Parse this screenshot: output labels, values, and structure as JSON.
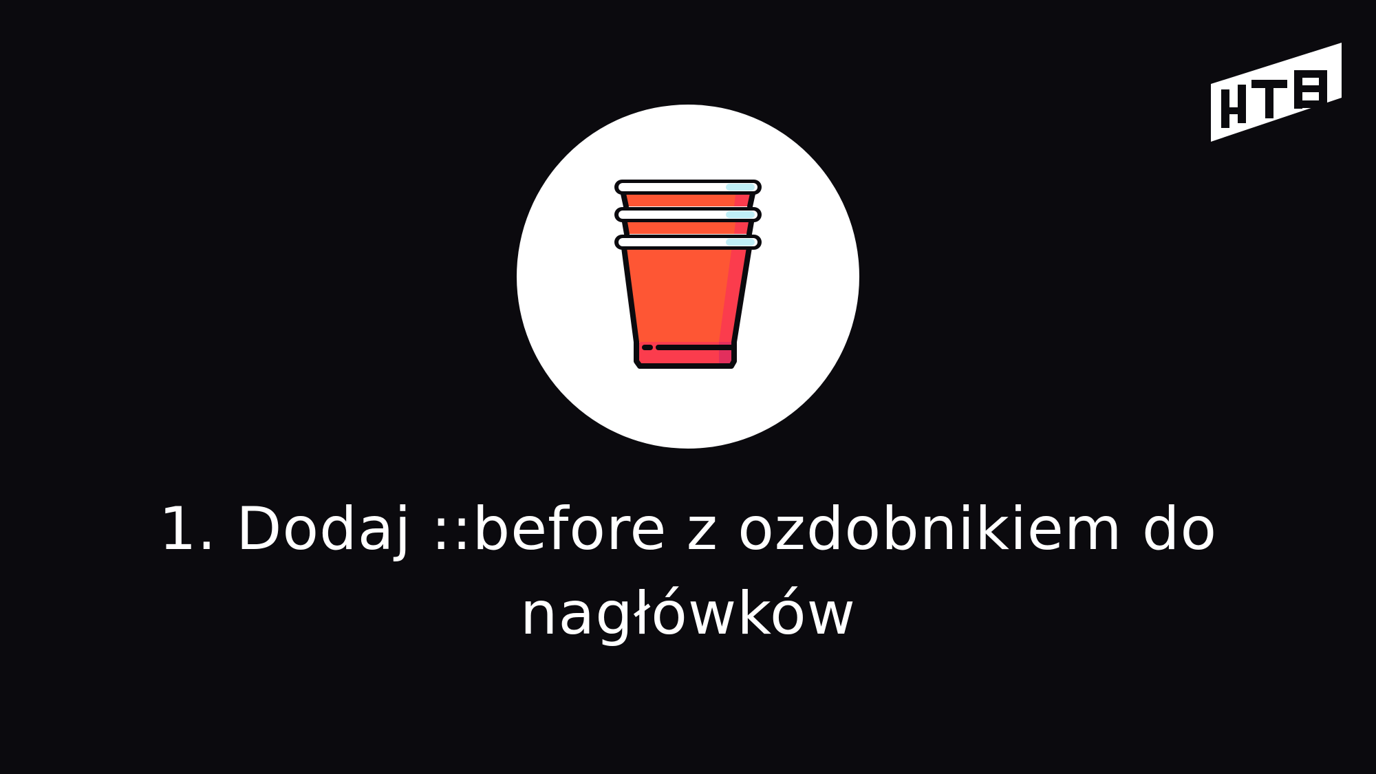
{
  "slide": {
    "title": "1. Dodaj ::before z ozdobnikiem do nagłówków",
    "icon": "stacked-party-cups-icon",
    "logo": "htb-logo"
  },
  "colors": {
    "background": "#0b0a0e",
    "text": "#ffffff",
    "circle": "#ffffff",
    "cup_primary": "#fe5634",
    "cup_secondary": "#fb3c4d",
    "cup_shade": "#e22f5d",
    "cup_rim": "#ffffff",
    "cup_rim_shine": "#bfeef6",
    "outline": "#0b0a0e"
  }
}
